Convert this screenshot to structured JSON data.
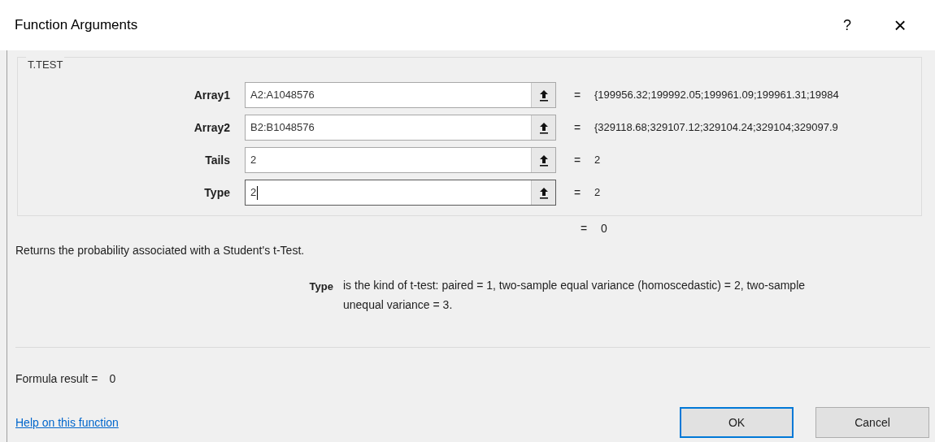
{
  "window": {
    "title": "Function Arguments",
    "controls": [
      {
        "kind": "help",
        "label": "?"
      },
      {
        "kind": "close",
        "label": "×"
      }
    ]
  },
  "group": {
    "title": "T.TEST",
    "arguments": [
      {
        "label": "Array1",
        "value": "A2:A1048576",
        "equals": "=",
        "result": "{199956.32;199992.05;199961.09;199961.31;19984",
        "focused": false
      },
      {
        "label": "Array2",
        "value": "B2:B1048576",
        "equals": "=",
        "result": "{329118.68;329107.12;329104.24;329104;329097.9",
        "focused": false
      },
      {
        "label": "Tails",
        "value": "2",
        "equals": "=",
        "result": "2",
        "focused": false
      },
      {
        "label": "Type",
        "value": "2",
        "equals": "=",
        "result": "2",
        "focused": true
      }
    ]
  },
  "function_result": {
    "equals": "=",
    "value": "0"
  },
  "description": "Returns the probability associated with a Student's t-Test.",
  "argument_help": {
    "name": "Type",
    "text": "is the kind of t-test: paired = 1, two-sample equal variance (homoscedastic) = 2, two-sample unequal variance = 3."
  },
  "formula_result": {
    "label": "Formula result =",
    "value": "0"
  },
  "help_link": "Help on this function",
  "buttons": [
    {
      "label": "OK",
      "default": true
    },
    {
      "label": "Cancel",
      "default": false
    }
  ]
}
